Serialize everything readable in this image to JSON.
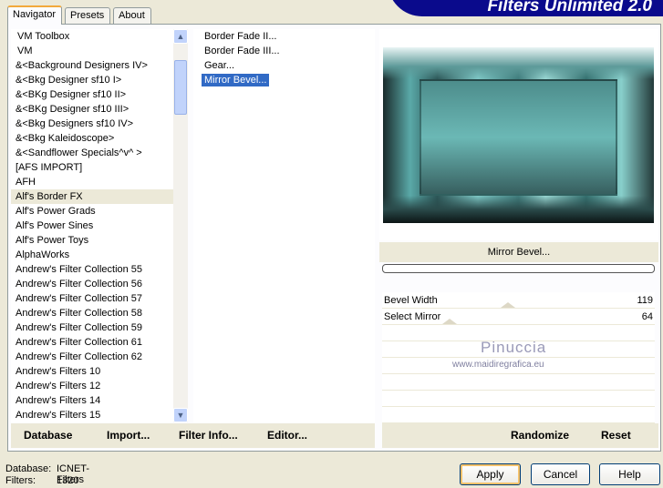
{
  "app": {
    "logo_text": "Filters Unlimited 2.0"
  },
  "tabs": [
    {
      "label": "Navigator"
    },
    {
      "label": "Presets"
    },
    {
      "label": "About"
    }
  ],
  "categories": [
    "VM Toolbox",
    "VM",
    "&<Background Designers IV>",
    "&<Bkg Designer sf10 I>",
    "&<BKg Designer sf10 II>",
    "&<BKg Designer sf10 III>",
    "&<Bkg Designers sf10 IV>",
    "&<Bkg Kaleidoscope>",
    "&<Sandflower Specials^v^ >",
    "[AFS IMPORT]",
    "AFH",
    "Alf's Border FX",
    "Alf's Power Grads",
    "Alf's Power Sines",
    "Alf's Power Toys",
    "AlphaWorks",
    "Andrew's Filter Collection 55",
    "Andrew's Filter Collection 56",
    "Andrew's Filter Collection 57",
    "Andrew's Filter Collection 58",
    "Andrew's Filter Collection 59",
    "Andrew's Filter Collection 61",
    "Andrew's Filter Collection 62",
    "Andrew's Filters 10",
    "Andrew's Filters 12",
    "Andrew's Filters 14",
    "Andrew's Filters 15"
  ],
  "selected_category": "Alf's Border FX",
  "filters": [
    "Border Fade II...",
    "Border Fade III...",
    "Gear...",
    "Mirror Bevel..."
  ],
  "selected_filter": "Mirror Bevel...",
  "preview": {
    "filter_name": "Mirror Bevel...",
    "progress": 0
  },
  "params": [
    {
      "label": "Bevel Width",
      "value": "119",
      "max": 255
    },
    {
      "label": "Select Mirror",
      "value": "64",
      "max": 255
    }
  ],
  "watermark": {
    "name": "Pinuccia",
    "url": "www.maidiregrafica.eu"
  },
  "buttons": {
    "database": "Database",
    "import": "Import...",
    "filter_info": "Filter Info...",
    "editor": "Editor...",
    "randomize": "Randomize",
    "reset": "Reset",
    "apply": "Apply",
    "cancel": "Cancel",
    "help": "Help"
  },
  "status": {
    "database_label": "Database:",
    "database_value": "ICNET-Filters",
    "filters_label": "Filters:",
    "filters_value": "1320"
  }
}
